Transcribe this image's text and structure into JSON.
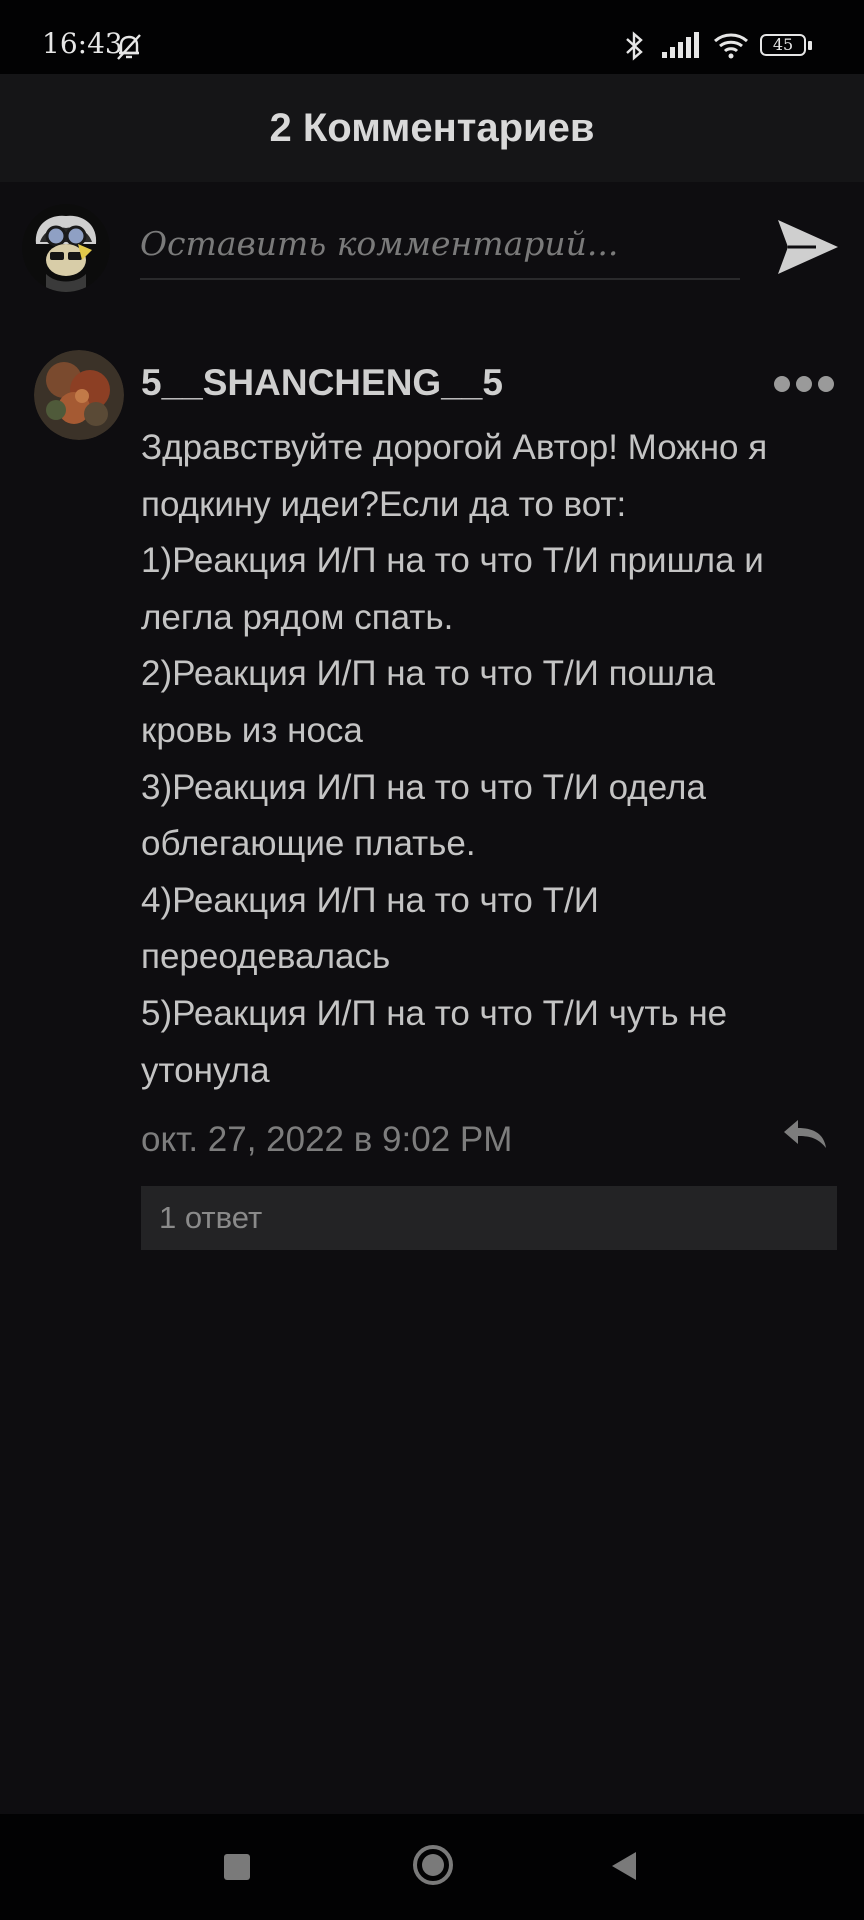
{
  "status_bar": {
    "time": "16:43",
    "battery_level": "45"
  },
  "header": {
    "title": "2 Комментариев"
  },
  "composer": {
    "placeholder": "Оставить комментарий..."
  },
  "comments": [
    {
      "author": "5__SHANCHENG__5",
      "lines": [
        "Здравствуйте дорогой Автор! Можно я",
        "подкину идеи?Если да то вот:",
        "1)Реакция И/П на то что Т/И пришла и",
        "легла рядом спать.",
        "2)Реакция И/П на то что Т/И пошла",
        "кровь из носа",
        "3)Реакция И/П на то что Т/И одела",
        "облегающие платье.",
        "4)Реакция И/П на то что Т/И",
        "переодевалась",
        "5)Реакция И/П на то что Т/И чуть не",
        "утонула"
      ],
      "timestamp": "окт. 27, 2022 в 9:02 PM",
      "replies_label": "1 ответ"
    }
  ],
  "colors": {
    "background": "#0e0d10",
    "header_background": "#151517",
    "replies_background": "#232325"
  }
}
